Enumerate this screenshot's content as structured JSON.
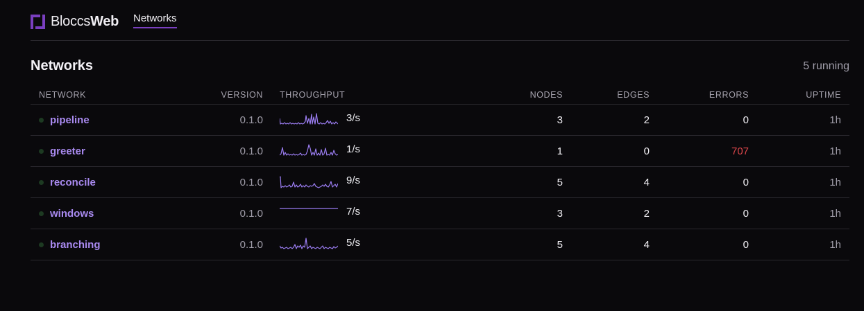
{
  "app": {
    "brand_light": "Bloccs",
    "brand_bold": "Web",
    "nav_tab": "Networks",
    "accent": "#7a3fc0"
  },
  "section": {
    "title": "Networks",
    "running": "5 running"
  },
  "columns": {
    "network": "NETWORK",
    "version": "VERSION",
    "throughput": "THROUGHPUT",
    "nodes": "NODES",
    "edges": "EDGES",
    "errors": "ERRORS",
    "uptime": "UPTIME"
  },
  "rows": [
    {
      "name": "pipeline",
      "version": "0.1.0",
      "rate": "3/s",
      "nodes": "3",
      "edges": "2",
      "errors": "0",
      "uptime": "1h",
      "error_highlight": false
    },
    {
      "name": "greeter",
      "version": "0.1.0",
      "rate": "1/s",
      "nodes": "1",
      "edges": "0",
      "errors": "707",
      "uptime": "1h",
      "error_highlight": true
    },
    {
      "name": "reconcile",
      "version": "0.1.0",
      "rate": "9/s",
      "nodes": "5",
      "edges": "4",
      "errors": "0",
      "uptime": "1h",
      "error_highlight": false
    },
    {
      "name": "windows",
      "version": "0.1.0",
      "rate": "7/s",
      "nodes": "3",
      "edges": "2",
      "errors": "0",
      "uptime": "1h",
      "error_highlight": false
    },
    {
      "name": "branching",
      "version": "0.1.0",
      "rate": "5/s",
      "nodes": "5",
      "edges": "4",
      "errors": "0",
      "uptime": "1h",
      "error_highlight": false
    }
  ],
  "colors": {
    "link": "#a98af0",
    "sparkline": "#9b7df2",
    "error": "#e0474c",
    "status_dot": "#1d3a22"
  }
}
